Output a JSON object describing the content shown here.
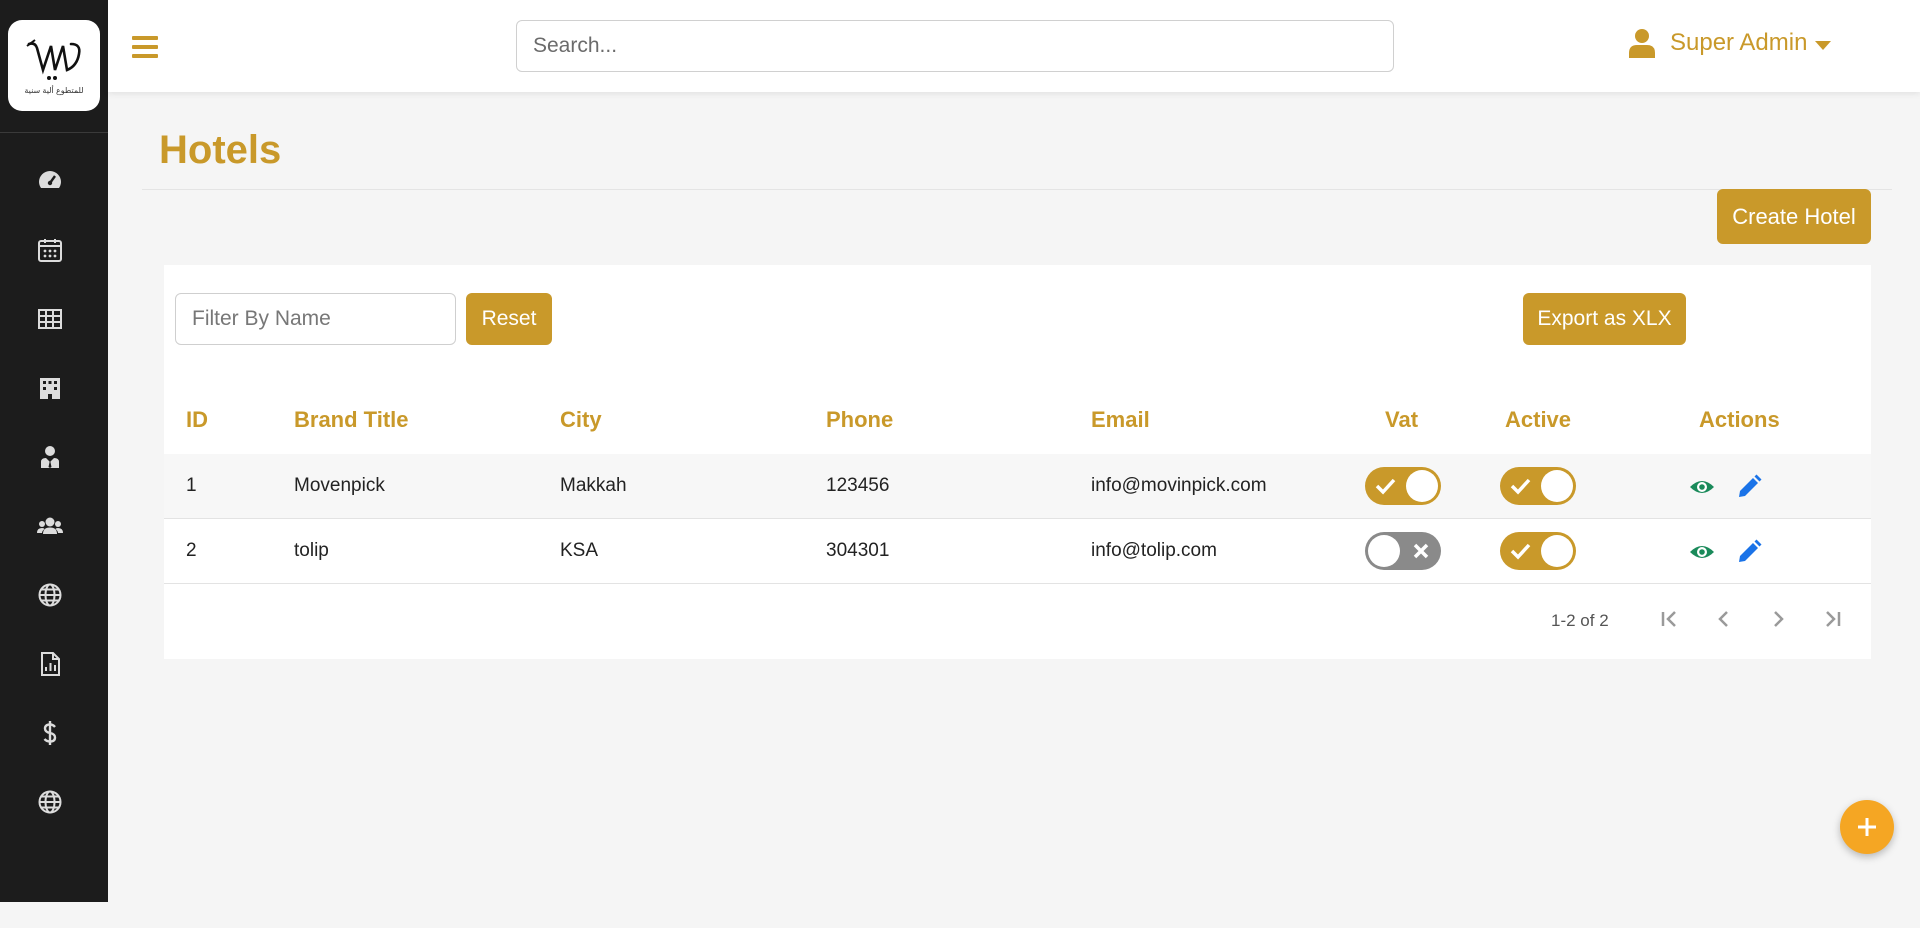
{
  "brand": {
    "logo_text": "للمتطوع ألية سنية"
  },
  "sidebar": {
    "items": [
      {
        "icon": "speedometer-icon"
      },
      {
        "icon": "calendar-icon"
      },
      {
        "icon": "table-icon"
      },
      {
        "icon": "building-icon"
      },
      {
        "icon": "user-tie-icon"
      },
      {
        "icon": "users-icon"
      },
      {
        "icon": "globe-icon"
      },
      {
        "icon": "report-icon"
      },
      {
        "icon": "dollar-icon"
      },
      {
        "icon": "globe-icon"
      }
    ]
  },
  "header": {
    "search_placeholder": "Search...",
    "user_name": "Super Admin"
  },
  "page": {
    "title": "Hotels",
    "create_button": "Create Hotel"
  },
  "toolbar": {
    "filter_placeholder": "Filter By Name",
    "reset_label": "Reset",
    "export_label": "Export as XLX"
  },
  "table": {
    "columns": [
      "ID",
      "Brand Title",
      "City",
      "Phone",
      "Email",
      "Vat",
      "Active",
      "Actions"
    ],
    "rows": [
      {
        "id": "1",
        "brand_title": "Movenpick",
        "city": "Makkah",
        "phone": "123456",
        "email": "info@movinpick.com",
        "vat": true,
        "active": true
      },
      {
        "id": "2",
        "brand_title": "tolip",
        "city": "KSA",
        "phone": "304301",
        "email": "info@tolip.com",
        "vat": false,
        "active": true
      }
    ]
  },
  "pagination": {
    "range_text": "1-2 of 2"
  },
  "colors": {
    "accent": "#c9992a",
    "sidebar": "#1c1c1c",
    "fab": "#f5a623",
    "view_icon": "#1a8a5a",
    "edit_icon": "#1a73e8"
  }
}
